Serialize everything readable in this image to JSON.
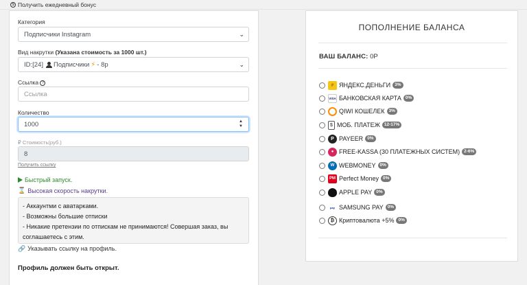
{
  "topbar": {
    "bonus_label": "Получить ежедневный бонус"
  },
  "form": {
    "category": {
      "label": "Категория",
      "value": "Подписчики Instagram"
    },
    "boost_type": {
      "label": "Вид накрутки",
      "label_hint": "(Указана стоимость за 1000 шт.)",
      "value_prefix": "ID:[24]",
      "value_name": "Подписчики",
      "value_price": "- 8р"
    },
    "link": {
      "label": "Ссылка",
      "placeholder": "Ссылка"
    },
    "quantity": {
      "label": "Количество",
      "value": "1000"
    },
    "cost": {
      "label": "₽ Стоимость(руб.)",
      "value": "8"
    },
    "get_link": "Получить ссылку",
    "features": [
      "Быстрый запуск.",
      "Высокая скорость накрутки."
    ],
    "description": [
      "- Аккаунтми с аватарками.",
      "- Возможны большие отписки",
      "- Никакие претензии по отпискам не принимаются! Совершая заказ, вы соглашаетесь с этим."
    ],
    "profile_link_note": "Указывать ссылку на профиль.",
    "profile_open": "Профиль должен быть открыт."
  },
  "balance_panel": {
    "title": "ПОПОЛНЕНИЕ БАЛАНСА",
    "balance_label": "ВАШ БАЛАНС:",
    "balance_value": "0Р",
    "methods": [
      {
        "name": "ЯНДЕКС.ДЕНЬГИ",
        "fee": "3%",
        "icon": "yandex-money-icon",
        "color": "#f5c518"
      },
      {
        "name": "БАНКОВСКАЯ КАРТА",
        "fee": "0%",
        "icon": "bank-card-icon",
        "color": "#1a1f71"
      },
      {
        "name": "QIWI КОШЕЛЕК",
        "fee": "3%",
        "icon": "qiwi-icon",
        "color": "#ff8c00"
      },
      {
        "name": "МОБ. ПЛАТЕЖ",
        "fee": "12-17%",
        "icon": "mobile-payment-icon",
        "color": "#555555"
      },
      {
        "name": "PAYEER",
        "fee": "0%",
        "icon": "payeer-icon",
        "color": "#222222"
      },
      {
        "name": "FREE-KASSA (30 ПЛАТЕЖНЫХ СИСТЕМ)",
        "fee": "2-6%",
        "icon": "free-kassa-icon",
        "color": "#d6245c"
      },
      {
        "name": "WEBMONEY",
        "fee": "0%",
        "icon": "webmoney-icon",
        "color": "#036cb5"
      },
      {
        "name": "Perfect Money",
        "fee": "0%",
        "icon": "perfect-money-icon",
        "color": "#e0001b"
      },
      {
        "name": "APPLE PAY",
        "fee": "0%",
        "icon": "apple-pay-icon",
        "color": "#111111"
      },
      {
        "name": "SAMSUNG PAY",
        "fee": "0%",
        "icon": "samsung-pay-icon",
        "color": "#1428a0"
      },
      {
        "name": "Криптовалюта +5%",
        "fee": "0%",
        "icon": "bitcoin-icon",
        "color": "#333333"
      }
    ]
  }
}
